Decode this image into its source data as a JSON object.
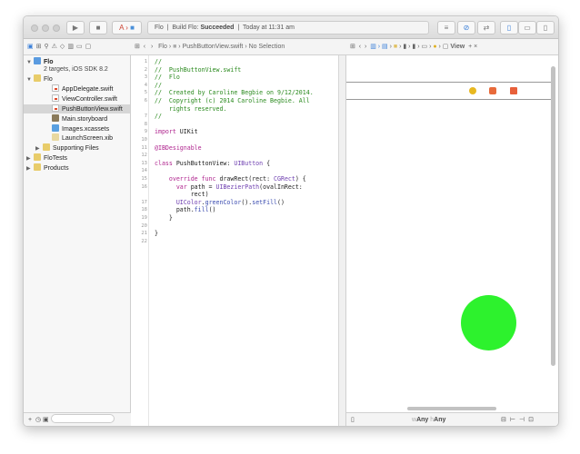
{
  "toolbar": {
    "scheme": "Flo",
    "activity_project": "Flo",
    "activity_build": "Build Flo:",
    "activity_status": "Succeeded",
    "activity_time": "Today at 11:31 am"
  },
  "jump_bar": {
    "project": "Flo",
    "file": "PushButtonView.swift",
    "selection": "No Selection"
  },
  "assistant_jump_bar": {
    "last": "View"
  },
  "navigator": {
    "project": {
      "name": "Flo",
      "subtitle": "2 targets, iOS SDK 8.2"
    },
    "items": [
      {
        "label": "Flo",
        "type": "folder",
        "depth": 1,
        "open": true
      },
      {
        "label": "AppDelegate.swift",
        "type": "swift",
        "depth": 3
      },
      {
        "label": "ViewController.swift",
        "type": "swift",
        "depth": 3
      },
      {
        "label": "PushButtonView.swift",
        "type": "swift",
        "depth": 3,
        "selected": true
      },
      {
        "label": "Main.storyboard",
        "type": "storyboard",
        "depth": 3
      },
      {
        "label": "Images.xcassets",
        "type": "assets",
        "depth": 3
      },
      {
        "label": "LaunchScreen.xib",
        "type": "xib",
        "depth": 3
      },
      {
        "label": "Supporting Files",
        "type": "folder",
        "depth": 2,
        "open": false
      },
      {
        "label": "FloTests",
        "type": "folder",
        "depth": 1,
        "open": false
      },
      {
        "label": "Products",
        "type": "folder",
        "depth": 1,
        "open": false
      }
    ]
  },
  "code": [
    {
      "n": "1",
      "segs": [
        [
          "//",
          "com"
        ]
      ]
    },
    {
      "n": "2",
      "segs": [
        [
          "//  PushButtonView.swift",
          "com"
        ]
      ]
    },
    {
      "n": "3",
      "segs": [
        [
          "//  Flo",
          "com"
        ]
      ]
    },
    {
      "n": "4",
      "segs": [
        [
          "//",
          "com"
        ]
      ]
    },
    {
      "n": "5",
      "segs": [
        [
          "//  Created by Caroline Begbie on 9/12/2014.",
          "com"
        ]
      ]
    },
    {
      "n": "6",
      "segs": [
        [
          "//  Copyright (c) 2014 Caroline Begbie. All",
          "com"
        ]
      ]
    },
    {
      "n": "",
      "segs": [
        [
          "    rights reserved.",
          "com"
        ]
      ]
    },
    {
      "n": "7",
      "segs": [
        [
          "//",
          "com"
        ]
      ]
    },
    {
      "n": "8",
      "segs": []
    },
    {
      "n": "9",
      "segs": [
        [
          "import",
          "kw"
        ],
        [
          " UIKit",
          ""
        ]
      ]
    },
    {
      "n": "10",
      "segs": []
    },
    {
      "n": "11",
      "segs": [
        [
          "@IBDesignable",
          "kw"
        ]
      ]
    },
    {
      "n": "12",
      "segs": []
    },
    {
      "n": "13",
      "segs": [
        [
          "class",
          "kw"
        ],
        [
          " PushButtonView: ",
          ""
        ],
        [
          "UIButton",
          "ty"
        ],
        [
          " {",
          ""
        ]
      ]
    },
    {
      "n": "14",
      "segs": []
    },
    {
      "n": "15",
      "segs": [
        [
          "    override func",
          "kw"
        ],
        [
          " drawRect(rect: ",
          ""
        ],
        [
          "CGRect",
          "ty"
        ],
        [
          ") {",
          ""
        ]
      ]
    },
    {
      "n": "16",
      "segs": [
        [
          "      var",
          "kw"
        ],
        [
          " path = ",
          ""
        ],
        [
          "UIBezierPath",
          "ty"
        ],
        [
          "(ovalInRect:",
          ""
        ]
      ]
    },
    {
      "n": "",
      "segs": [
        [
          "          rect)",
          ""
        ]
      ]
    },
    {
      "n": "17",
      "segs": [
        [
          "      ",
          ""
        ],
        [
          "UIColor",
          "ty"
        ],
        [
          ".",
          ""
        ],
        [
          "greenColor",
          "fn"
        ],
        [
          "().",
          ""
        ],
        [
          "setFill",
          "fn"
        ],
        [
          "()",
          ""
        ]
      ]
    },
    {
      "n": "18",
      "segs": [
        [
          "      path.",
          ""
        ],
        [
          "fill",
          "fn"
        ],
        [
          "()",
          ""
        ]
      ]
    },
    {
      "n": "19",
      "segs": [
        [
          "    }",
          ""
        ]
      ]
    },
    {
      "n": "20",
      "segs": []
    },
    {
      "n": "21",
      "segs": [
        [
          "}",
          ""
        ]
      ]
    },
    {
      "n": "22",
      "segs": []
    }
  ],
  "canvas": {
    "button_fill": "#2DF22D",
    "scene_dock_icons": [
      "view-controller-icon",
      "first-responder-icon",
      "exit-icon"
    ]
  },
  "size_class": {
    "w_prefix": "w",
    "w": "Any",
    "h_prefix": "h",
    "h": "Any"
  }
}
